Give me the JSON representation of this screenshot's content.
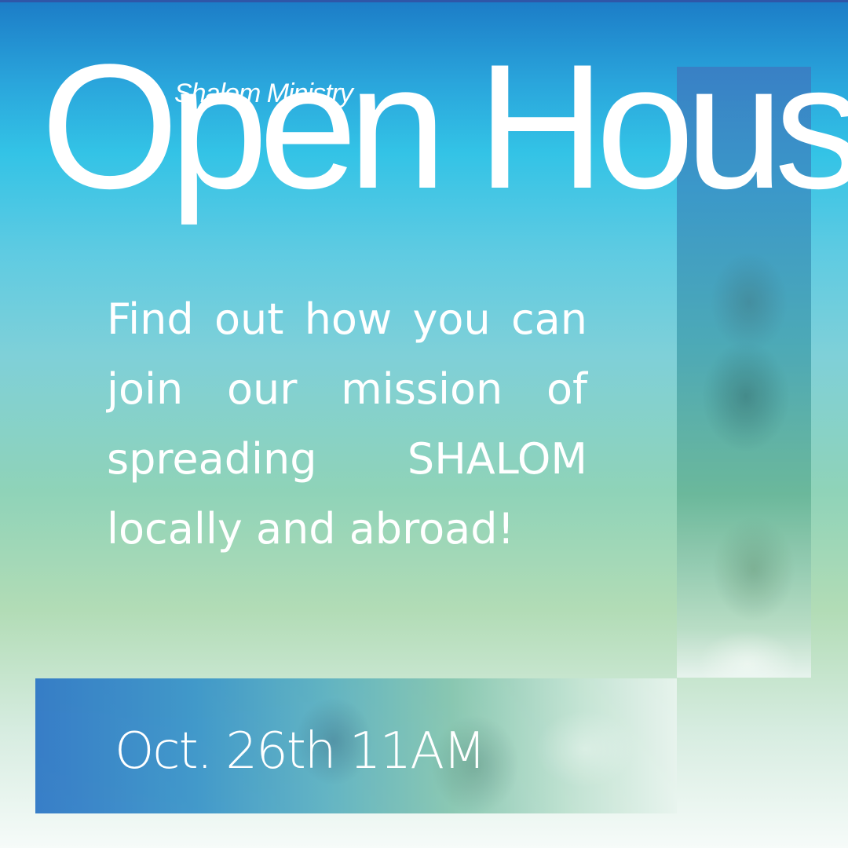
{
  "header": {
    "ministry_name": "Shalom Ministry",
    "title": "Open House"
  },
  "message": {
    "text": "Find out how you can join our mission of spreading SHALOM locally and abroad!"
  },
  "event": {
    "date_time": "Oct. 26th 11AM"
  },
  "colors": {
    "top_blue": "#1c7cc7",
    "mid_cyan": "#33c3e6",
    "mid_green": "#8fd3b8",
    "bottom_white": "#f6fbf9",
    "text": "#ffffff"
  }
}
